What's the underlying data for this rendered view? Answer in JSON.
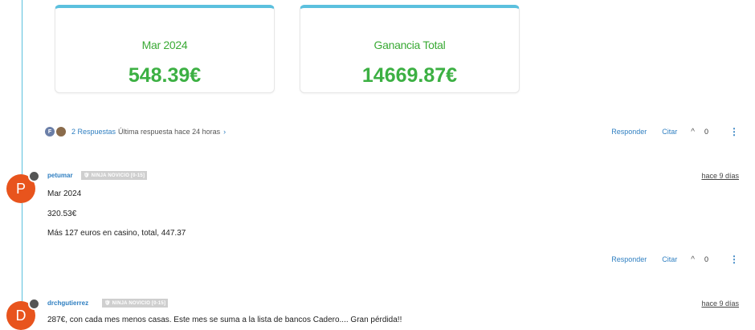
{
  "cards": [
    {
      "label": "Mar 2024",
      "value": "548.39€"
    },
    {
      "label": "Ganancia Total",
      "value": "14669.87€"
    }
  ],
  "replies": {
    "avatar_letter": "F",
    "count_text": "2 Respuestas",
    "meta": "Última respuesta hace 24 horas",
    "chevron": "›"
  },
  "actions": {
    "reply": "Responder",
    "quote": "Citar",
    "upvote_icon": "^",
    "votes_1": "0",
    "votes_2": "0",
    "more_icon": "⋮"
  },
  "posts": [
    {
      "avatar_letter": "P",
      "author": "petumar",
      "badge": "🛡 NINJA NOVICIO [0-15]",
      "time": "hace 9 días",
      "lines": [
        "Mar 2024",
        "320.53€",
        "Más 127 euros en casino, total, 447.37"
      ]
    },
    {
      "avatar_letter": "D",
      "author": "drchgutierrez",
      "badge": "🛡 NINJA NOVICIO [0-15]",
      "time": "hace 9 días",
      "lines": [
        "287€, con cada mes menos casas. Este mes se suma a la lista de bancos Cadero.... Gran pérdida!!"
      ]
    }
  ],
  "colors": {
    "accent": "#2f7fc1",
    "green": "#3cb043",
    "card_top": "#5bc0de",
    "avatar": "#e8541d"
  }
}
